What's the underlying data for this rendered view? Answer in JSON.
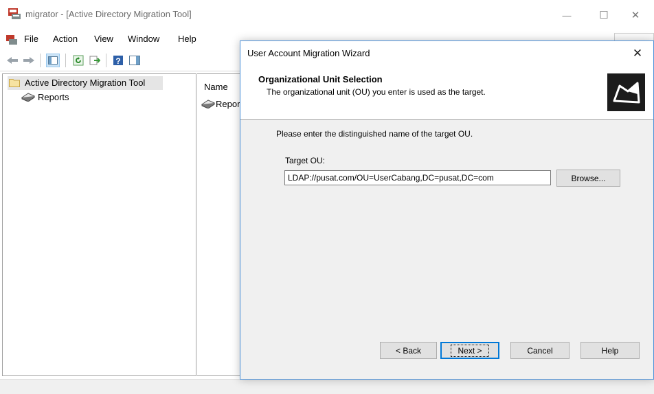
{
  "window": {
    "title": "migrator - [Active Directory Migration Tool]",
    "minimize": "—",
    "maximize": "☐",
    "close": "✕"
  },
  "menu": [
    "File",
    "Action",
    "View",
    "Window",
    "Help"
  ],
  "toolbar": {
    "icons": [
      "back-arrow-icon",
      "forward-arrow-icon",
      "show-hide-tree-icon",
      "refresh-icon",
      "export-list-icon",
      "help-icon",
      "show-hide-action-pane-icon"
    ]
  },
  "tree": {
    "root_label": "Active Directory Migration Tool",
    "items": [
      "Reports"
    ]
  },
  "results": {
    "column_name": "Name",
    "rows": [
      "Repor"
    ]
  },
  "wizard": {
    "title": "User Account Migration Wizard",
    "close": "✕",
    "heading": "Organizational Unit Selection",
    "subheading": "The organizational unit (OU) you enter is used as the target.",
    "prompt": "Please enter the distinguished name of the target OU.",
    "target_label": "Target OU:",
    "target_value": "LDAP://pusat.com/OU=UserCabang,DC=pusat,DC=com",
    "browse_label": "Browse...",
    "buttons": {
      "back": "< Back",
      "next": "Next >",
      "cancel": "Cancel",
      "help": "Help"
    }
  },
  "colors": {
    "accent_border": "#4a90d9",
    "dialog_bg": "#f0f0f0",
    "selection_bg": "#e5e5e5",
    "default_button_border": "#0078d7"
  }
}
